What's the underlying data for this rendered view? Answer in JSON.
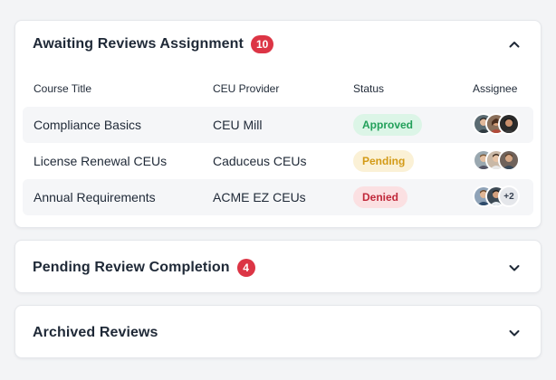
{
  "sections": [
    {
      "title": "Awaiting Reviews Assignment",
      "count": "10",
      "expanded": true,
      "columns": [
        "Course Title",
        "CEU Provider",
        "Status",
        "Assignee"
      ],
      "rows": [
        {
          "course": "Compliance Basics",
          "provider": "CEU Mill",
          "status": "Approved",
          "extra": ""
        },
        {
          "course": "License Renewal CEUs",
          "provider": "Caduceus CEUs",
          "status": "Pending",
          "extra": ""
        },
        {
          "course": "Annual Requirements",
          "provider": "ACME EZ CEUs",
          "status": "Denied",
          "extra": "+2"
        }
      ]
    },
    {
      "title": "Pending Review Completion",
      "count": "4",
      "expanded": false
    },
    {
      "title": "Archived Reviews",
      "expanded": false
    }
  ],
  "colors": {
    "badge": "#dc3545",
    "approved": "#22a05a",
    "pending": "#d39a16",
    "denied": "#c0283a"
  },
  "icons": {
    "collapse": "chevron-up-icon",
    "expand": "chevron-down-icon"
  }
}
